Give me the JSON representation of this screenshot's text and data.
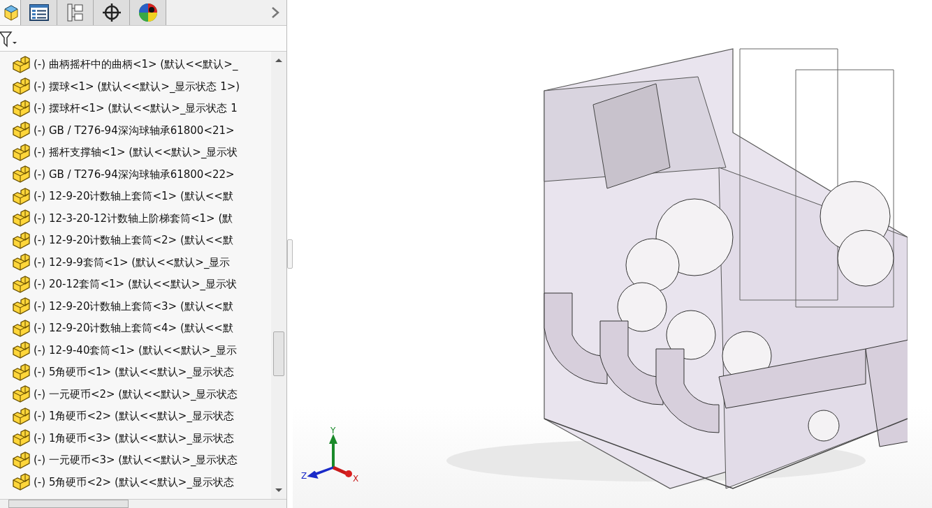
{
  "panel_tabs": [
    {
      "kind": "part",
      "selected": true
    },
    {
      "kind": "property-list",
      "selected": false
    },
    {
      "kind": "configuration",
      "selected": false
    },
    {
      "kind": "target",
      "selected": false
    },
    {
      "kind": "appearance",
      "selected": false
    }
  ],
  "tree": {
    "items": [
      {
        "label": "(-) 曲柄摇杆中的曲柄<1> (默认<<默认>_"
      },
      {
        "label": "(-) 摆球<1> (默认<<默认>_显示状态 1>)"
      },
      {
        "label": "(-) 摆球杆<1> (默认<<默认>_显示状态 1"
      },
      {
        "label": "(-) GB / T276-94深沟球轴承61800<21>"
      },
      {
        "label": "(-) 摇杆支撑轴<1> (默认<<默认>_显示状"
      },
      {
        "label": "(-) GB / T276-94深沟球轴承61800<22>"
      },
      {
        "label": "(-) 12-9-20计数轴上套筒<1> (默认<<默"
      },
      {
        "label": "(-) 12-3-20-12计数轴上阶梯套筒<1> (默"
      },
      {
        "label": "(-) 12-9-20计数轴上套筒<2> (默认<<默"
      },
      {
        "label": "(-) 12-9-9套筒<1> (默认<<默认>_显示"
      },
      {
        "label": "(-) 20-12套筒<1> (默认<<默认>_显示状"
      },
      {
        "label": "(-) 12-9-20计数轴上套筒<3> (默认<<默"
      },
      {
        "label": "(-) 12-9-20计数轴上套筒<4> (默认<<默"
      },
      {
        "label": "(-) 12-9-40套筒<1> (默认<<默认>_显示"
      },
      {
        "label": "(-) 5角硬币<1> (默认<<默认>_显示状态"
      },
      {
        "label": "(-) 一元硬币<2> (默认<<默认>_显示状态"
      },
      {
        "label": "(-) 1角硬币<2> (默认<<默认>_显示状态"
      },
      {
        "label": "(-) 1角硬币<3> (默认<<默认>_显示状态"
      },
      {
        "label": "(-) 一元硬币<3> (默认<<默认>_显示状态"
      },
      {
        "label": "(-) 5角硬币<2> (默认<<默认>_显示状态"
      }
    ]
  },
  "triad": {
    "x": "X",
    "y": "Y",
    "z": "Z"
  }
}
